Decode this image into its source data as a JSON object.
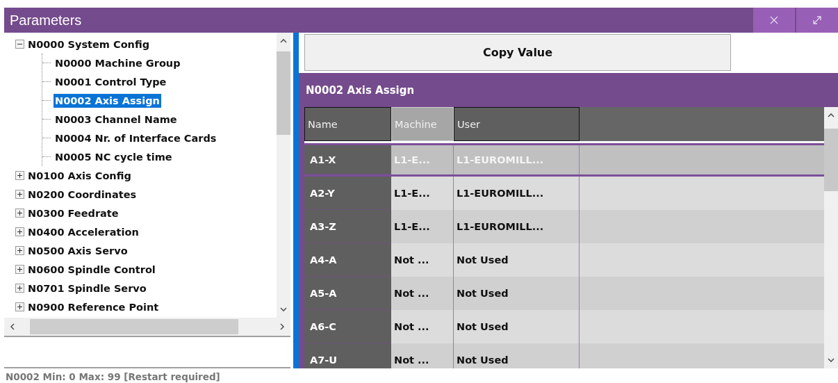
{
  "window": {
    "title": "Parameters"
  },
  "tree": {
    "nodes": [
      {
        "label": "N0000 System Config",
        "expanded": true,
        "selected": false,
        "children": [
          {
            "label": "N0000 Machine Group",
            "selected": false
          },
          {
            "label": "N0001 Control Type",
            "selected": false
          },
          {
            "label": "N0002 Axis Assign",
            "selected": true
          },
          {
            "label": "N0003 Channel Name",
            "selected": false
          },
          {
            "label": "N0004 Nr. of Interface Cards",
            "selected": false
          },
          {
            "label": "N0005 NC cycle time",
            "selected": false
          }
        ]
      },
      {
        "label": "N0100 Axis Config",
        "expanded": false,
        "selected": false
      },
      {
        "label": "N0200 Coordinates",
        "expanded": false,
        "selected": false
      },
      {
        "label": "N0300 Feedrate",
        "expanded": false,
        "selected": false
      },
      {
        "label": "N0400 Acceleration",
        "expanded": false,
        "selected": false
      },
      {
        "label": "N0500 Axis Servo",
        "expanded": false,
        "selected": false
      },
      {
        "label": "N0600 Spindle Control",
        "expanded": false,
        "selected": false
      },
      {
        "label": "N0701 Spindle Servo",
        "expanded": false,
        "selected": false
      },
      {
        "label": "N0900 Reference Point",
        "expanded": false,
        "selected": false
      }
    ]
  },
  "copy_button": "Copy Value",
  "table": {
    "title": "N0002 Axis Assign",
    "columns": [
      {
        "label": "Name",
        "selected": false
      },
      {
        "label": "Machine",
        "selected": true
      },
      {
        "label": "User",
        "selected": false
      }
    ],
    "rows": [
      {
        "name": "A1-X",
        "machine": "L1-E...",
        "user": "L1-EUROMILL...",
        "selected": true
      },
      {
        "name": "A2-Y",
        "machine": "L1-E...",
        "user": "L1-EUROMILL...",
        "selected": false
      },
      {
        "name": "A3-Z",
        "machine": "L1-E...",
        "user": "L1-EUROMILL...",
        "selected": false
      },
      {
        "name": "A4-A",
        "machine": "Not ...",
        "user": "Not Used",
        "selected": false
      },
      {
        "name": "A5-A",
        "machine": "Not ...",
        "user": "Not Used",
        "selected": false
      },
      {
        "name": "A6-C",
        "machine": "Not ...",
        "user": "Not Used",
        "selected": false
      },
      {
        "name": "A7-U",
        "machine": "Not ...",
        "user": "Not Used",
        "selected": false
      }
    ]
  },
  "status_bar": "N0002 Min: 0 Max: 99 [Restart required]"
}
